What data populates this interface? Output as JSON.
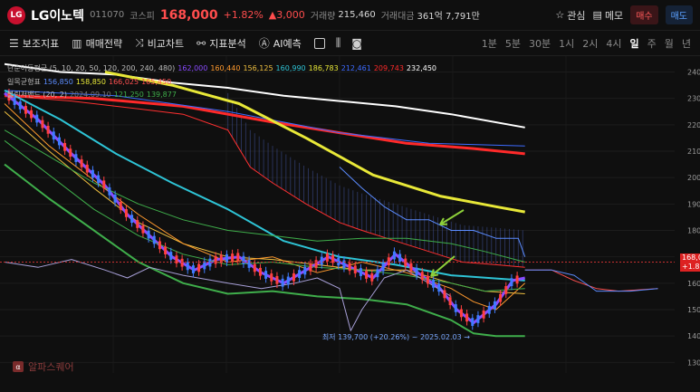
{
  "header": {
    "logo_text": "LG",
    "name": "LG이노텍",
    "code": "011070",
    "market": "코스피",
    "price": "168,000",
    "change_pct": "+1.82%",
    "change_abs": "▲3,000",
    "volume_label": "거래량",
    "volume": "215,460",
    "amount_label": "거래대금",
    "amount": "361억 7,791만",
    "watch": "관심",
    "memo": "메모",
    "buy": "매수",
    "sell": "매도"
  },
  "toolbar": {
    "tools": [
      "보조지표",
      "매매전략",
      "비교차트",
      "지표분석",
      "AI예측"
    ],
    "timeframes": [
      "1분",
      "5분",
      "30분",
      "1시",
      "2시",
      "4시",
      "일",
      "주",
      "월",
      "년"
    ],
    "active_timeframe": "일"
  },
  "legend": {
    "row1_title": "단순이동평균 (5, 10, 20, 50, 120, 200, 240, 480)",
    "row1_values": [
      "162,000",
      "160,440",
      "156,125",
      "160,990",
      "186,783",
      "212,461",
      "209,743",
      "232,450"
    ],
    "row1_colors": [
      "#8a4bff",
      "#ff9a2e",
      "#f0c040",
      "#2ec4d6",
      "#e8e838",
      "#3d6bff",
      "#ff2a2a",
      "#ffffff"
    ],
    "row2_title": "일목균형표",
    "row2_values": [
      "156,850",
      "158,850",
      "166,025",
      "165,450"
    ],
    "row2_colors": [
      "#5b8cff",
      "#e8e838",
      "#ff5050",
      "#ff5050"
    ],
    "row3_title": "볼린저밴드 (20, 2)",
    "row3_values": [
      "2024.09.10",
      "121,250",
      "139,877"
    ],
    "row3_colors": [
      "#7a7a7a",
      "#3fae4b",
      "#3fae4b"
    ]
  },
  "annotation": {
    "low_label": "최저 139,700 (+20.26%) ~ 2025.02.03 →"
  },
  "current_price_tag": [
    "168,0",
    "+1.82"
  ],
  "watermark": "알파스퀘어",
  "chart_data": {
    "type": "line",
    "y_ticks": [
      240,
      230,
      220,
      210,
      200,
      190,
      180,
      170,
      160,
      150,
      140,
      130
    ],
    "ylim": [
      126,
      246
    ],
    "x_count": 100,
    "series": [
      {
        "name": "MA480",
        "color": "#ffffff",
        "width": 2,
        "values": [
          [
            0,
            243
          ],
          [
            50,
            240
          ],
          [
            100,
            239
          ],
          [
            150,
            236
          ],
          [
            200,
            234
          ],
          [
            250,
            231
          ],
          [
            300,
            229
          ],
          [
            350,
            227
          ],
          [
            400,
            224
          ],
          [
            466,
            219
          ]
        ]
      },
      {
        "name": "MA240",
        "color": "#ff2a2a",
        "width": 3,
        "values": [
          [
            0,
            231
          ],
          [
            80,
            230
          ],
          [
            160,
            227
          ],
          [
            240,
            221
          ],
          [
            300,
            217
          ],
          [
            360,
            213
          ],
          [
            420,
            211
          ],
          [
            466,
            209
          ]
        ]
      },
      {
        "name": "MA200",
        "color": "#3d6bff",
        "width": 1,
        "values": [
          [
            0,
            233
          ],
          [
            100,
            231
          ],
          [
            200,
            225
          ],
          [
            300,
            217
          ],
          [
            380,
            213
          ],
          [
            466,
            212
          ]
        ]
      },
      {
        "name": "MA120",
        "color": "#e8e838",
        "width": 3,
        "values": [
          [
            90,
            240
          ],
          [
            150,
            235
          ],
          [
            210,
            228
          ],
          [
            270,
            215
          ],
          [
            330,
            201
          ],
          [
            390,
            193
          ],
          [
            440,
            189
          ],
          [
            466,
            187
          ]
        ]
      },
      {
        "name": "MA50",
        "color": "#2ec4d6",
        "width": 2,
        "values": [
          [
            0,
            233
          ],
          [
            50,
            222
          ],
          [
            100,
            209
          ],
          [
            150,
            198
          ],
          [
            200,
            188
          ],
          [
            250,
            176
          ],
          [
            300,
            170
          ],
          [
            350,
            167
          ],
          [
            400,
            163
          ],
          [
            466,
            161
          ]
        ]
      },
      {
        "name": "MA20",
        "color": "#f0c040",
        "width": 1,
        "values": [
          [
            0,
            225
          ],
          [
            40,
            210
          ],
          [
            80,
            196
          ],
          [
            120,
            183
          ],
          [
            160,
            175
          ],
          [
            200,
            170
          ],
          [
            240,
            169
          ],
          [
            280,
            167
          ],
          [
            320,
            165
          ],
          [
            360,
            165
          ],
          [
            400,
            160
          ],
          [
            430,
            157
          ],
          [
            466,
            156
          ]
        ]
      },
      {
        "name": "MA10",
        "color": "#ff9a2e",
        "width": 1,
        "values": [
          [
            0,
            228
          ],
          [
            40,
            212
          ],
          [
            80,
            199
          ],
          [
            120,
            186
          ],
          [
            160,
            175
          ],
          [
            200,
            168
          ],
          [
            240,
            170
          ],
          [
            280,
            164
          ],
          [
            320,
            168
          ],
          [
            360,
            164
          ],
          [
            400,
            158
          ],
          [
            420,
            153
          ],
          [
            440,
            150
          ],
          [
            466,
            160
          ]
        ]
      },
      {
        "name": "MA5",
        "color": "#8a4bff",
        "width": 3,
        "values": [
          [
            0,
            232
          ],
          [
            30,
            222
          ],
          [
            60,
            209
          ],
          [
            90,
            197
          ],
          [
            110,
            186
          ],
          [
            130,
            178
          ],
          [
            150,
            170
          ],
          [
            170,
            165
          ],
          [
            190,
            169
          ],
          [
            210,
            170
          ],
          [
            230,
            164
          ],
          [
            250,
            160
          ],
          [
            270,
            165
          ],
          [
            290,
            170
          ],
          [
            310,
            166
          ],
          [
            330,
            162
          ],
          [
            350,
            171
          ],
          [
            370,
            164
          ],
          [
            390,
            158
          ],
          [
            405,
            150
          ],
          [
            420,
            145
          ],
          [
            440,
            152
          ],
          [
            455,
            161
          ],
          [
            466,
            162
          ]
        ]
      },
      {
        "name": "BB-upper",
        "color": "#3fae4b",
        "width": 1,
        "values": [
          [
            0,
            218
          ],
          [
            40,
            208
          ],
          [
            80,
            198
          ],
          [
            120,
            190
          ],
          [
            160,
            184
          ],
          [
            200,
            180
          ],
          [
            240,
            178
          ],
          [
            280,
            176
          ],
          [
            320,
            177
          ],
          [
            360,
            177
          ],
          [
            400,
            175
          ],
          [
            430,
            172
          ],
          [
            466,
            168
          ]
        ]
      },
      {
        "name": "BB-mid",
        "color": "#3fae4b",
        "width": 1,
        "values": [
          [
            0,
            214
          ],
          [
            40,
            201
          ],
          [
            80,
            188
          ],
          [
            120,
            178
          ],
          [
            160,
            171
          ],
          [
            200,
            167
          ],
          [
            240,
            168
          ],
          [
            280,
            166
          ],
          [
            320,
            165
          ],
          [
            360,
            163
          ],
          [
            400,
            160
          ],
          [
            430,
            157
          ],
          [
            466,
            158
          ]
        ]
      },
      {
        "name": "BB-lower",
        "color": "#3fae4b",
        "width": 2,
        "values": [
          [
            0,
            205
          ],
          [
            40,
            192
          ],
          [
            80,
            180
          ],
          [
            120,
            168
          ],
          [
            160,
            160
          ],
          [
            200,
            156
          ],
          [
            240,
            157
          ],
          [
            280,
            155
          ],
          [
            320,
            154
          ],
          [
            360,
            152
          ],
          [
            400,
            146
          ],
          [
            420,
            141
          ],
          [
            440,
            140
          ],
          [
            466,
            140
          ]
        ]
      },
      {
        "name": "Lagging",
        "color": "#a8a0d8",
        "width": 1,
        "values": [
          [
            0,
            168
          ],
          [
            30,
            166
          ],
          [
            60,
            169
          ],
          [
            90,
            165
          ],
          [
            110,
            162
          ],
          [
            130,
            166
          ],
          [
            160,
            163
          ],
          [
            200,
            160
          ],
          [
            230,
            158
          ],
          [
            260,
            160
          ],
          [
            280,
            162
          ],
          [
            300,
            158
          ],
          [
            310,
            142
          ],
          [
            320,
            150
          ],
          [
            340,
            162
          ],
          [
            360,
            165
          ],
          [
            380,
            160
          ],
          [
            400,
            155
          ]
        ]
      },
      {
        "name": "Kijun",
        "color": "#5b8cff",
        "width": 1,
        "values": [
          [
            300,
            204
          ],
          [
            320,
            196
          ],
          [
            340,
            189
          ],
          [
            360,
            184
          ],
          [
            380,
            184
          ],
          [
            400,
            180
          ],
          [
            420,
            180
          ],
          [
            440,
            177
          ],
          [
            460,
            177
          ],
          [
            466,
            170
          ]
        ]
      },
      {
        "name": "SpanA-fwd",
        "color": "#ff5050",
        "width": 1,
        "values": [
          [
            466,
            165
          ],
          [
            490,
            165
          ],
          [
            510,
            161
          ],
          [
            530,
            158
          ],
          [
            550,
            157
          ],
          [
            585,
            158
          ]
        ]
      },
      {
        "name": "SpanB-fwd",
        "color": "#5b8cff",
        "width": 1,
        "values": [
          [
            466,
            165
          ],
          [
            490,
            165
          ],
          [
            510,
            163
          ],
          [
            530,
            157
          ],
          [
            560,
            157
          ],
          [
            585,
            158
          ]
        ]
      }
    ],
    "red_upper": {
      "color": "#ff3030",
      "values": [
        [
          0,
          231
        ],
        [
          60,
          229
        ],
        [
          120,
          226
        ],
        [
          160,
          224
        ],
        [
          200,
          218
        ],
        [
          220,
          204
        ],
        [
          240,
          198
        ],
        [
          270,
          190
        ],
        [
          300,
          183
        ],
        [
          320,
          180
        ],
        [
          350,
          176
        ],
        [
          380,
          172
        ],
        [
          410,
          168
        ],
        [
          440,
          167
        ],
        [
          466,
          166
        ]
      ]
    },
    "lows_x": 420,
    "lows_y": 139.7,
    "current_price": 168,
    "x_range": [
      0,
      600
    ]
  }
}
